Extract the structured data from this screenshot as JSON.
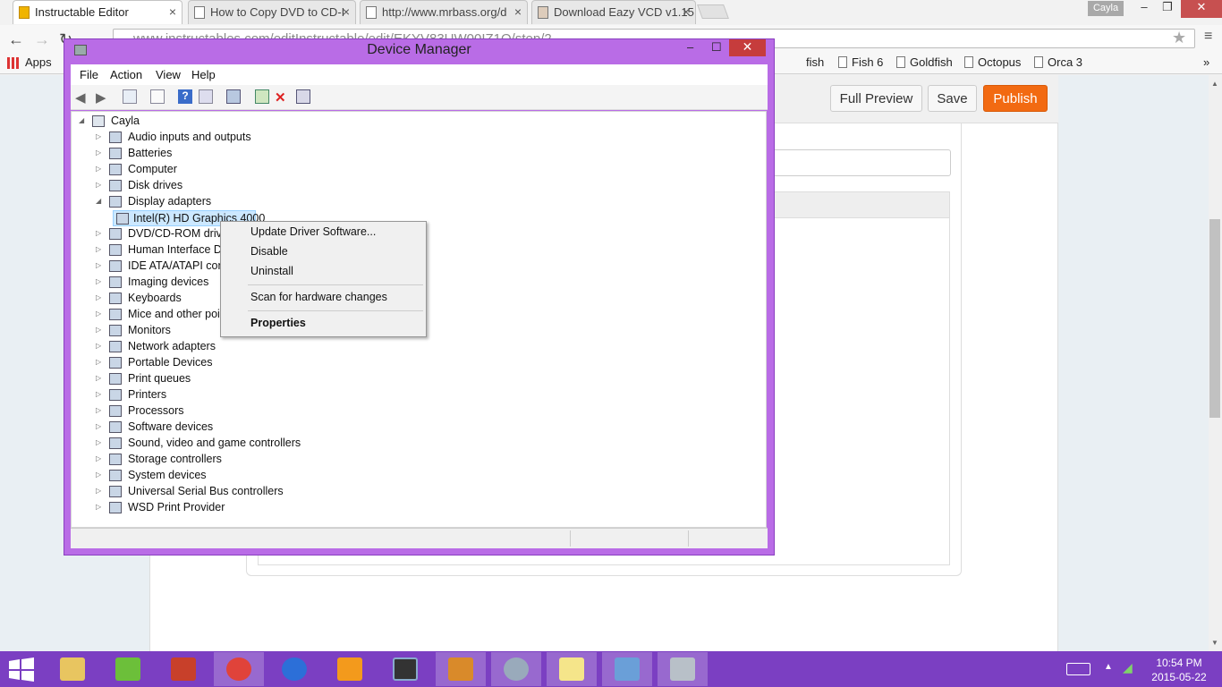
{
  "browser": {
    "tabs": [
      {
        "label": "Instructable Editor",
        "active": true,
        "icon": "instructables-robot-icon"
      },
      {
        "label": "How to Copy DVD to CD-I",
        "active": false,
        "icon": "page-icon"
      },
      {
        "label": "http://www.mrbass.org/d",
        "active": false,
        "icon": "page-icon"
      },
      {
        "label": "Download Eazy VCD v1.15",
        "active": false,
        "icon": "eazy-vcd-icon"
      }
    ],
    "user": "Cayla",
    "address": "www.instructables.com/editInstructable/edit/EKYV83UW00IZ1Q/step/2",
    "bookmarks": [
      "Apps",
      "fish",
      "Fish 6",
      "Goldfish",
      "Octopus",
      "Orca 3"
    ],
    "bookmarks_overflow": "»"
  },
  "editor": {
    "full_preview": "Full Preview",
    "save": "Save",
    "publish": "Publish",
    "accent": "#f26a12"
  },
  "device_manager": {
    "title": "Device Manager",
    "menus": [
      "File",
      "Action",
      "View",
      "Help"
    ],
    "root": "Cayla",
    "items": [
      {
        "label": "Audio inputs and outputs",
        "icon": "speaker-icon"
      },
      {
        "label": "Batteries",
        "icon": "battery-icon"
      },
      {
        "label": "Computer",
        "icon": "computer-icon"
      },
      {
        "label": "Disk drives",
        "icon": "disk-drive-icon"
      },
      {
        "label": "Display adapters",
        "icon": "display-adapter-icon",
        "expanded": true
      },
      {
        "label": "Intel(R) HD Graphics 4000",
        "icon": "display-adapter-icon",
        "child": true,
        "selected": true
      },
      {
        "label": "DVD/CD-ROM drive",
        "icon": "optical-drive-icon"
      },
      {
        "label": "Human Interface De",
        "icon": "hid-icon"
      },
      {
        "label": "IDE ATA/ATAPI con",
        "icon": "ide-controller-icon"
      },
      {
        "label": "Imaging devices",
        "icon": "camera-icon"
      },
      {
        "label": "Keyboards",
        "icon": "keyboard-icon"
      },
      {
        "label": "Mice and other poir",
        "icon": "mouse-icon"
      },
      {
        "label": "Monitors",
        "icon": "monitor-icon"
      },
      {
        "label": "Network adapters",
        "icon": "network-adapter-icon"
      },
      {
        "label": "Portable Devices",
        "icon": "portable-device-icon"
      },
      {
        "label": "Print queues",
        "icon": "print-queue-icon"
      },
      {
        "label": "Printers",
        "icon": "printer-icon"
      },
      {
        "label": "Processors",
        "icon": "processor-icon"
      },
      {
        "label": "Software devices",
        "icon": "software-device-icon"
      },
      {
        "label": "Sound, video and game controllers",
        "icon": "speaker-icon"
      },
      {
        "label": "Storage controllers",
        "icon": "storage-controller-icon"
      },
      {
        "label": "System devices",
        "icon": "system-device-icon"
      },
      {
        "label": "Universal Serial Bus controllers",
        "icon": "usb-icon"
      },
      {
        "label": "WSD Print Provider",
        "icon": "printer-icon"
      }
    ],
    "context_menu": {
      "update": "Update Driver Software...",
      "disable": "Disable",
      "uninstall": "Uninstall",
      "scan": "Scan for hardware changes",
      "properties": "Properties"
    },
    "frame_color": "#b96ce6"
  },
  "taskbar": {
    "time": "10:54 PM",
    "date": "2015-05-22",
    "color": "#7b3fc2"
  }
}
